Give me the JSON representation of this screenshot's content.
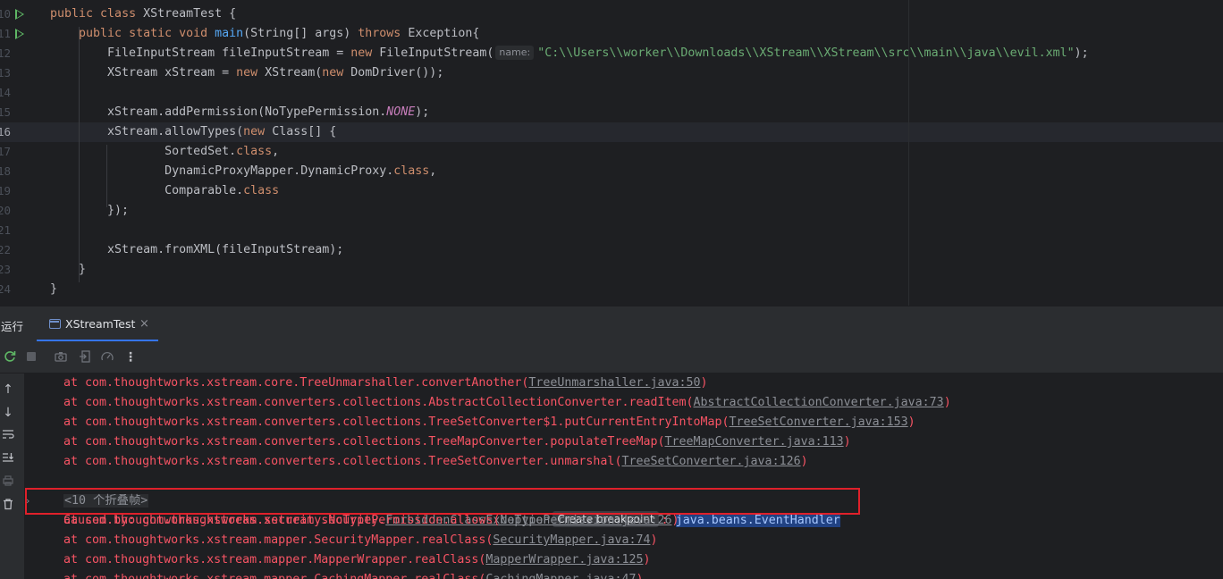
{
  "editor": {
    "lines": [
      {
        "num": "10",
        "run": true,
        "current": false,
        "tokens": [
          [
            "kw",
            "public "
          ],
          [
            "kw",
            "class "
          ],
          [
            "plain",
            "XStreamTest {"
          ]
        ]
      },
      {
        "num": "11",
        "run": true,
        "current": false,
        "tokens": [
          [
            "plain",
            "    "
          ],
          [
            "kw",
            "public static void "
          ],
          [
            "fn",
            "main"
          ],
          [
            "plain",
            "(String[] args) "
          ],
          [
            "kw",
            "throws "
          ],
          [
            "plain",
            "Exception{"
          ]
        ]
      },
      {
        "num": "12",
        "run": false,
        "current": false,
        "tokens": [
          [
            "plain",
            "        FileInputStream fileInputStream = "
          ],
          [
            "kw",
            "new "
          ],
          [
            "plain",
            "FileInputStream("
          ],
          [
            "hint",
            "name:"
          ],
          [
            "str",
            "\"C:\\\\Users\\\\worker\\\\Downloads\\\\XStream\\\\XStream\\\\src\\\\main\\\\java\\\\evil.xml\""
          ],
          [
            "plain",
            ");"
          ]
        ]
      },
      {
        "num": "13",
        "run": false,
        "current": false,
        "tokens": [
          [
            "plain",
            "        XStream xStream = "
          ],
          [
            "kw",
            "new "
          ],
          [
            "plain",
            "XStream("
          ],
          [
            "kw",
            "new "
          ],
          [
            "plain",
            "DomDriver());"
          ]
        ]
      },
      {
        "num": "14",
        "run": false,
        "current": false,
        "tokens": []
      },
      {
        "num": "15",
        "run": false,
        "current": false,
        "tokens": [
          [
            "plain",
            "        xStream.addPermission(NoTypePermission."
          ],
          [
            "const",
            "NONE"
          ],
          [
            "plain",
            ");"
          ]
        ]
      },
      {
        "num": "16",
        "run": false,
        "current": true,
        "tokens": [
          [
            "plain",
            "        xStream.allowTypes("
          ],
          [
            "kw",
            "new "
          ],
          [
            "plain",
            "Class[] {"
          ]
        ]
      },
      {
        "num": "17",
        "run": false,
        "current": false,
        "tokens": [
          [
            "plain",
            "                SortedSet."
          ],
          [
            "kw",
            "class"
          ],
          [
            "plain",
            ","
          ]
        ]
      },
      {
        "num": "18",
        "run": false,
        "current": false,
        "tokens": [
          [
            "plain",
            "                DynamicProxyMapper.DynamicProxy."
          ],
          [
            "kw",
            "class"
          ],
          [
            "plain",
            ","
          ]
        ]
      },
      {
        "num": "19",
        "run": false,
        "current": false,
        "tokens": [
          [
            "plain",
            "                Comparable."
          ],
          [
            "kw",
            "class"
          ]
        ]
      },
      {
        "num": "20",
        "run": false,
        "current": false,
        "tokens": [
          [
            "plain",
            "        });"
          ]
        ]
      },
      {
        "num": "21",
        "run": false,
        "current": false,
        "tokens": []
      },
      {
        "num": "22",
        "run": false,
        "current": false,
        "tokens": [
          [
            "plain",
            "        xStream.fromXML(fileInputStream);"
          ]
        ]
      },
      {
        "num": "23",
        "run": false,
        "current": false,
        "tokens": [
          [
            "plain",
            "    }"
          ]
        ]
      },
      {
        "num": "24",
        "run": false,
        "current": false,
        "tokens": [
          [
            "plain",
            "}"
          ]
        ]
      }
    ]
  },
  "run_panel": {
    "title": "运行",
    "tab_label": "XStreamTest",
    "tab_close": "×",
    "toolbar_icons": [
      "rerun-icon",
      "stop-icon",
      "camera-icon",
      "exit-icon",
      "coverage-icon",
      "more-icon"
    ],
    "side_icons": [
      "up-arrow-icon",
      "down-arrow-icon",
      "soft-wrap-icon",
      "scroll-to-end-icon",
      "print-icon",
      "trash-icon"
    ]
  },
  "console": {
    "frames_before": [
      {
        "prefix": "    at com.thoughtworks.xstream.core.TreeUnmarshaller.convertAnother(",
        "link": "TreeUnmarshaller.java:50",
        "suffix": ")"
      },
      {
        "prefix": "    at com.thoughtworks.xstream.converters.collections.AbstractCollectionConverter.readItem(",
        "link": "AbstractCollectionConverter.java:73",
        "suffix": ")"
      },
      {
        "prefix": "    at com.thoughtworks.xstream.converters.collections.TreeSetConverter$1.putCurrentEntryIntoMap(",
        "link": "TreeSetConverter.java:153",
        "suffix": ")"
      },
      {
        "prefix": "    at com.thoughtworks.xstream.converters.collections.TreeMapConverter.populateTreeMap(",
        "link": "TreeMapConverter.java:113",
        "suffix": ")"
      },
      {
        "prefix": "    at com.thoughtworks.xstream.converters.collections.TreeSetConverter.unmarshal(",
        "link": "TreeSetConverter.java:126",
        "suffix": ")"
      }
    ],
    "fold_text": "<10 个折叠帧>",
    "caused_by": {
      "prefix": "Caused by: com.thoughtworks.xstream.security.",
      "exception_link": "ForbiddenClassException",
      "breakpoint_button": "Create breakpoint",
      "separator": ": ",
      "selected_text": "java.beans.EventHandler"
    },
    "frames_after": [
      {
        "prefix": "    at com.thoughtworks.xstream.security.NoTypePermission.allows(",
        "link": "NoTypePermission.java:26",
        "suffix": ")"
      },
      {
        "prefix": "    at com.thoughtworks.xstream.mapper.SecurityMapper.realClass(",
        "link": "SecurityMapper.java:74",
        "suffix": ")"
      },
      {
        "prefix": "    at com.thoughtworks.xstream.mapper.MapperWrapper.realClass(",
        "link": "MapperWrapper.java:125",
        "suffix": ")"
      },
      {
        "prefix": "    at com.thoughtworks.xstream.mapper.CachingMapper.realClass(",
        "link": "CachingMapper.java:47",
        "suffix": ")"
      }
    ]
  },
  "colors": {
    "error_text": "#f75464",
    "highlight_box": "#e0202a",
    "selection": "#214283",
    "tab_accent": "#3574f0"
  }
}
